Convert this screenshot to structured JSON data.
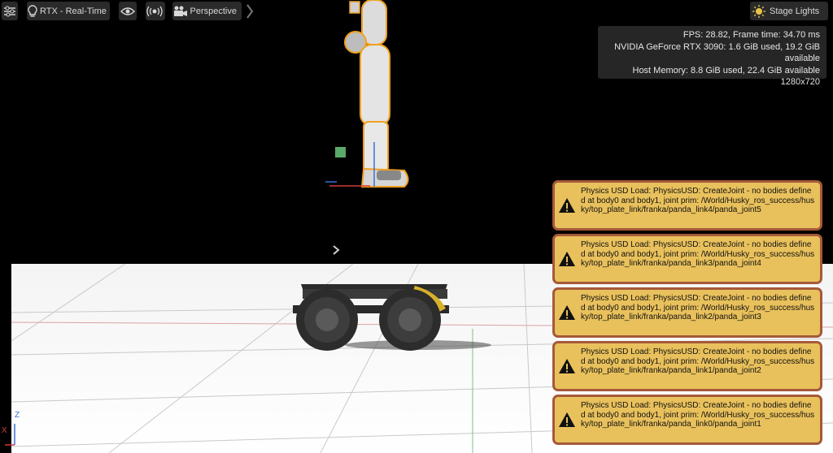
{
  "toolbar": {
    "settings_icon": "sliders-icon",
    "render_mode": {
      "icon": "lightbulb-icon",
      "label": "RTX - Real-Time"
    },
    "eye_icon": "eye-icon",
    "broadcast_icon": "broadcast-icon",
    "camera": {
      "icon": "movie-camera-icon",
      "label": "Perspective"
    },
    "more_icon": "chevron-right-icon",
    "lights": {
      "icon": "sun-icon",
      "label": "Stage Lights"
    }
  },
  "stats": {
    "fps_line": "FPS: 28.82, Frame time: 34.70 ms",
    "gpu_line": "NVIDIA GeForce RTX 3090: 1.6 GiB used, 19.2 GiB available",
    "host_line": "Host Memory: 8.8 GiB used, 22.4 GiB available",
    "resolution": "1280x720"
  },
  "axis": {
    "z": "Z",
    "x": "X"
  },
  "toasts": [
    {
      "icon": "warning-icon",
      "text": "Physics USD Load: PhysicsUSD: CreateJoint - no bodies defined at body0 and body1, joint prim: /World/Husky_ros_success/husky/top_plate_link/franka/panda_link4/panda_joint5"
    },
    {
      "icon": "warning-icon",
      "text": "Physics USD Load: PhysicsUSD: CreateJoint - no bodies defined at body0 and body1, joint prim: /World/Husky_ros_success/husky/top_plate_link/franka/panda_link3/panda_joint4"
    },
    {
      "icon": "warning-icon",
      "text": "Physics USD Load: PhysicsUSD: CreateJoint - no bodies defined at body0 and body1, joint prim: /World/Husky_ros_success/husky/top_plate_link/franka/panda_link2/panda_joint3"
    },
    {
      "icon": "warning-icon",
      "text": "Physics USD Load: PhysicsUSD: CreateJoint - no bodies defined at body0 and body1, joint prim: /World/Husky_ros_success/husky/top_plate_link/franka/panda_link1/panda_joint2"
    },
    {
      "icon": "warning-icon",
      "text": "Physics USD Load: PhysicsUSD: CreateJoint - no bodies defined at body0 and body1, joint prim: /World/Husky_ros_success/husky/top_plate_link/franka/panda_link0/panda_joint1"
    }
  ]
}
